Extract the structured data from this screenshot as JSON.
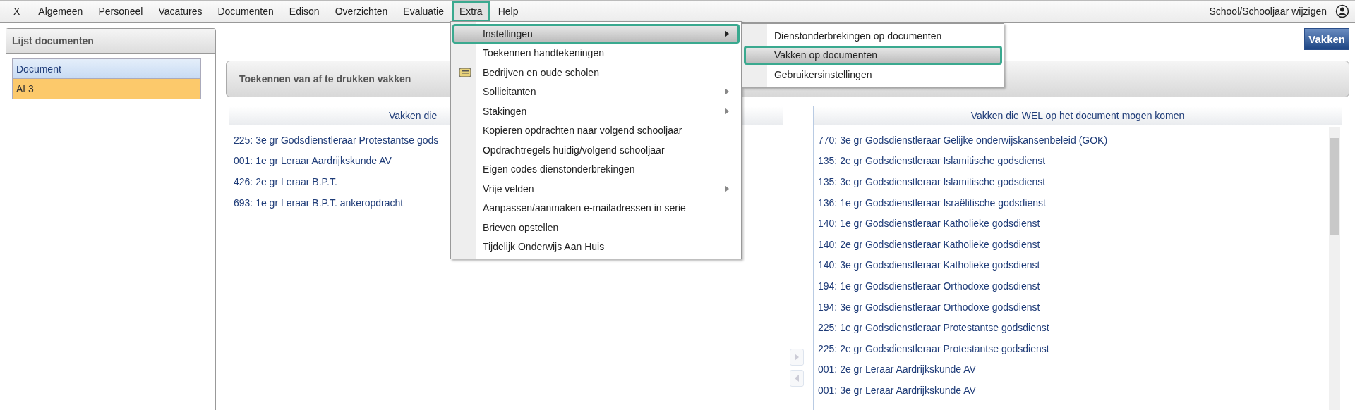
{
  "menu_bar": {
    "items": [
      {
        "label": "X",
        "selected": false
      },
      {
        "label": "Algemeen",
        "selected": false
      },
      {
        "label": "Personeel",
        "selected": false
      },
      {
        "label": "Vacatures",
        "selected": false
      },
      {
        "label": "Documenten",
        "selected": false
      },
      {
        "label": "Edison",
        "selected": false
      },
      {
        "label": "Overzichten",
        "selected": false
      },
      {
        "label": "Evaluatie",
        "selected": false
      },
      {
        "label": "Extra",
        "selected": true
      },
      {
        "label": "Help",
        "selected": false
      }
    ],
    "right_link": "School/Schooljaar wijzigen"
  },
  "extra_menu": {
    "items": [
      {
        "label": "Instellingen",
        "kind": "submenu",
        "selected": true
      },
      {
        "label": "Toekennen handtekeningen",
        "kind": "command",
        "selected": false
      },
      {
        "label": "Bedrijven en oude scholen",
        "kind": "icon",
        "selected": false
      },
      {
        "label": "Sollicitanten",
        "kind": "submenu",
        "selected": false
      },
      {
        "label": "Stakingen",
        "kind": "submenu",
        "selected": false
      },
      {
        "label": "Kopieren opdrachten naar volgend schooljaar",
        "kind": "command",
        "selected": false
      },
      {
        "label": "Opdrachtregels huidig/volgend schooljaar",
        "kind": "command",
        "selected": false
      },
      {
        "label": "Eigen codes dienstonderbrekingen",
        "kind": "command",
        "selected": false
      },
      {
        "label": "Vrije velden",
        "kind": "submenu",
        "selected": false
      },
      {
        "label": "Aanpassen/aanmaken e-mailadressen in serie",
        "kind": "command",
        "selected": false
      },
      {
        "label": "Brieven opstellen",
        "kind": "command",
        "selected": false
      },
      {
        "label": "Tijdelijk Onderwijs Aan Huis",
        "kind": "command",
        "selected": false
      }
    ],
    "submenu": [
      {
        "label": "Dienstonderbrekingen op documenten",
        "selected": false
      },
      {
        "label": "Vakken op documenten",
        "selected": true
      },
      {
        "label": "Gebruikersinstellingen",
        "selected": false
      }
    ]
  },
  "left_panel": {
    "title": "Lijst documenten",
    "column": "Document",
    "rows": [
      {
        "label": "AL3",
        "selected": true
      }
    ]
  },
  "vakken_button": "Vakken",
  "section_title": "Toekennen van af te drukken vakken",
  "not_allowed_list": {
    "header": "Vakken die",
    "items": [
      "225: 3e gr Godsdienstleraar Protestantse gods",
      "001: 1e gr Leraar Aardrijkskunde AV",
      "426: 2e gr Leraar B.P.T.",
      "693: 1e gr Leraar B.P.T. ankeropdracht"
    ]
  },
  "transfer_buttons": [
    {
      "kind": "right",
      "disabled": true
    },
    {
      "kind": "left",
      "disabled": true
    }
  ],
  "allowed_list": {
    "header": "Vakken die WEL op het document mogen komen",
    "items": [
      "770: 3e gr Godsdienstleraar Gelijke onderwijskansenbeleid (GOK)",
      "135: 2e gr Godsdienstleraar Islamitische godsdienst",
      "135: 3e gr Godsdienstleraar Islamitische godsdienst",
      "136: 1e gr Godsdienstleraar Israëlitische godsdienst",
      "140: 1e gr Godsdienstleraar Katholieke godsdienst",
      "140: 2e gr Godsdienstleraar Katholieke godsdienst",
      "140: 3e gr Godsdienstleraar Katholieke godsdienst",
      "194: 1e gr Godsdienstleraar Orthodoxe godsdienst",
      "194: 3e gr Godsdienstleraar Orthodoxe godsdienst",
      "225: 1e gr Godsdienstleraar Protestantse godsdienst",
      "225: 2e gr Godsdienstleraar Protestantse godsdienst",
      "001: 2e gr Leraar Aardrijkskunde AV",
      "001: 3e gr Leraar Aardrijkskunde AV"
    ]
  }
}
